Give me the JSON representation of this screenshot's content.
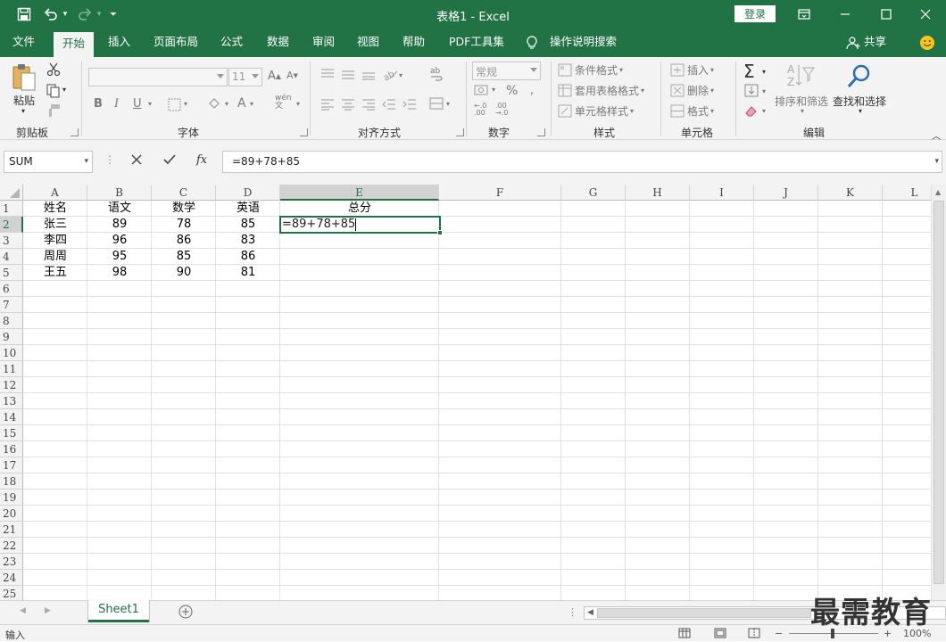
{
  "window": {
    "title": "表格1  -  Excel",
    "login_label": "登录"
  },
  "tabs": [
    {
      "label": "文件"
    },
    {
      "label": "开始"
    },
    {
      "label": "插入"
    },
    {
      "label": "页面布局"
    },
    {
      "label": "公式"
    },
    {
      "label": "数据"
    },
    {
      "label": "审阅"
    },
    {
      "label": "视图"
    },
    {
      "label": "帮助"
    },
    {
      "label": "PDF工具集"
    },
    {
      "label": "操作说明搜索"
    }
  ],
  "share_label": "共享",
  "ribbon": {
    "clipboard": {
      "paste": "粘贴",
      "group": "剪贴板"
    },
    "font": {
      "size": "11",
      "bold": "B",
      "italic": "I",
      "underline": "U",
      "group": "字体"
    },
    "align": {
      "group": "对齐方式"
    },
    "number": {
      "format": "常规",
      "percent": "%",
      "group": "数字",
      "dec_inc": "←.0\n.00",
      "dec_dec": ".00\n→.0"
    },
    "styles": {
      "conditional": "条件格式",
      "table": "套用表格格式",
      "cell": "单元格样式",
      "group": "样式"
    },
    "cells": {
      "insert": "插入",
      "delete": "删除",
      "format": "格式",
      "group": "单元格"
    },
    "editing": {
      "sort": "排序和筛选",
      "find": "查找和选择",
      "group": "编辑"
    }
  },
  "formula_bar": {
    "name_box": "SUM",
    "fx": "fx",
    "value": "=89+78+85"
  },
  "columns": [
    "A",
    "B",
    "C",
    "D",
    "E",
    "F",
    "G",
    "H",
    "I",
    "J",
    "K",
    "L"
  ],
  "rows": [
    "1",
    "2",
    "3",
    "4",
    "5",
    "6",
    "7",
    "8",
    "9",
    "10",
    "11",
    "12",
    "13",
    "14",
    "15",
    "16",
    "17",
    "18",
    "19",
    "20",
    "21",
    "22",
    "23",
    "24",
    "25"
  ],
  "cells": {
    "header": [
      "姓名",
      "语文",
      "数学",
      "英语",
      "总分"
    ],
    "data": [
      [
        "张三",
        "89",
        "78",
        "85"
      ],
      [
        "李四",
        "96",
        "86",
        "83"
      ],
      [
        "周周",
        "95",
        "85",
        "86"
      ],
      [
        "王五",
        "98",
        "90",
        "81"
      ]
    ],
    "editing_value": "=89+78+85"
  },
  "sheet_tab": "Sheet1",
  "status": {
    "mode": "输入",
    "zoom": "100%"
  },
  "watermark": "最需教育",
  "colors": {
    "accent": "#217346"
  }
}
